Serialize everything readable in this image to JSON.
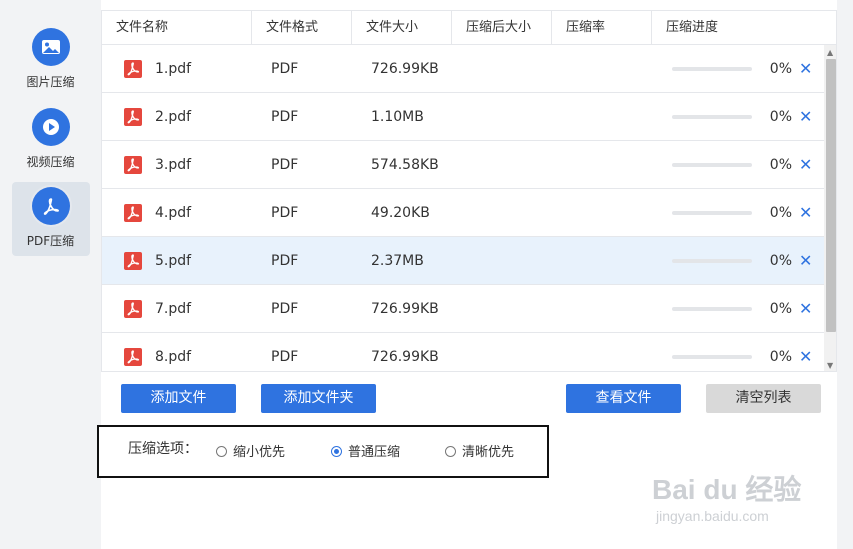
{
  "sidebar": {
    "items": [
      {
        "label": "图片压缩",
        "icon": "image-icon"
      },
      {
        "label": "视频压缩",
        "icon": "play-icon"
      },
      {
        "label": "PDF压缩",
        "icon": "pdf-icon",
        "active": true
      }
    ]
  },
  "table": {
    "headers": [
      "文件名称",
      "文件格式",
      "文件大小",
      "压缩后大小",
      "压缩率",
      "压缩进度"
    ],
    "rows": [
      {
        "name": "1.pdf",
        "format": "PDF",
        "size": "726.99KB",
        "compressed_size": "",
        "ratio": "",
        "progress": 0,
        "progress_text": "0%"
      },
      {
        "name": "2.pdf",
        "format": "PDF",
        "size": "1.10MB",
        "compressed_size": "",
        "ratio": "",
        "progress": 0,
        "progress_text": "0%"
      },
      {
        "name": "3.pdf",
        "format": "PDF",
        "size": "574.58KB",
        "compressed_size": "",
        "ratio": "",
        "progress": 0,
        "progress_text": "0%"
      },
      {
        "name": "4.pdf",
        "format": "PDF",
        "size": "49.20KB",
        "compressed_size": "",
        "ratio": "",
        "progress": 0,
        "progress_text": "0%"
      },
      {
        "name": "5.pdf",
        "format": "PDF",
        "size": "2.37MB",
        "compressed_size": "",
        "ratio": "",
        "progress": 0,
        "progress_text": "0%",
        "selected": true
      },
      {
        "name": "7.pdf",
        "format": "PDF",
        "size": "726.99KB",
        "compressed_size": "",
        "ratio": "",
        "progress": 0,
        "progress_text": "0%"
      },
      {
        "name": "8.pdf",
        "format": "PDF",
        "size": "726.99KB",
        "compressed_size": "",
        "ratio": "",
        "progress": 0,
        "progress_text": "0%"
      }
    ],
    "delete_glyph": "✕"
  },
  "buttons": {
    "add_file": "添加文件",
    "add_folder": "添加文件夹",
    "view_files": "查看文件",
    "clear_list": "清空列表"
  },
  "options": {
    "label": "压缩选项：",
    "choices": [
      {
        "label": "缩小优先",
        "selected": false
      },
      {
        "label": "普通压缩",
        "selected": true
      },
      {
        "label": "清晰优先",
        "selected": false
      }
    ]
  },
  "watermark": {
    "main": "Bai du 经验",
    "sub": "jingyan.baidu.com"
  },
  "colors": {
    "accent": "#2f73e0",
    "pdf_red": "#e5473d",
    "selected_row": "#e8f2fc",
    "disabled_button": "#d9d9d9"
  }
}
